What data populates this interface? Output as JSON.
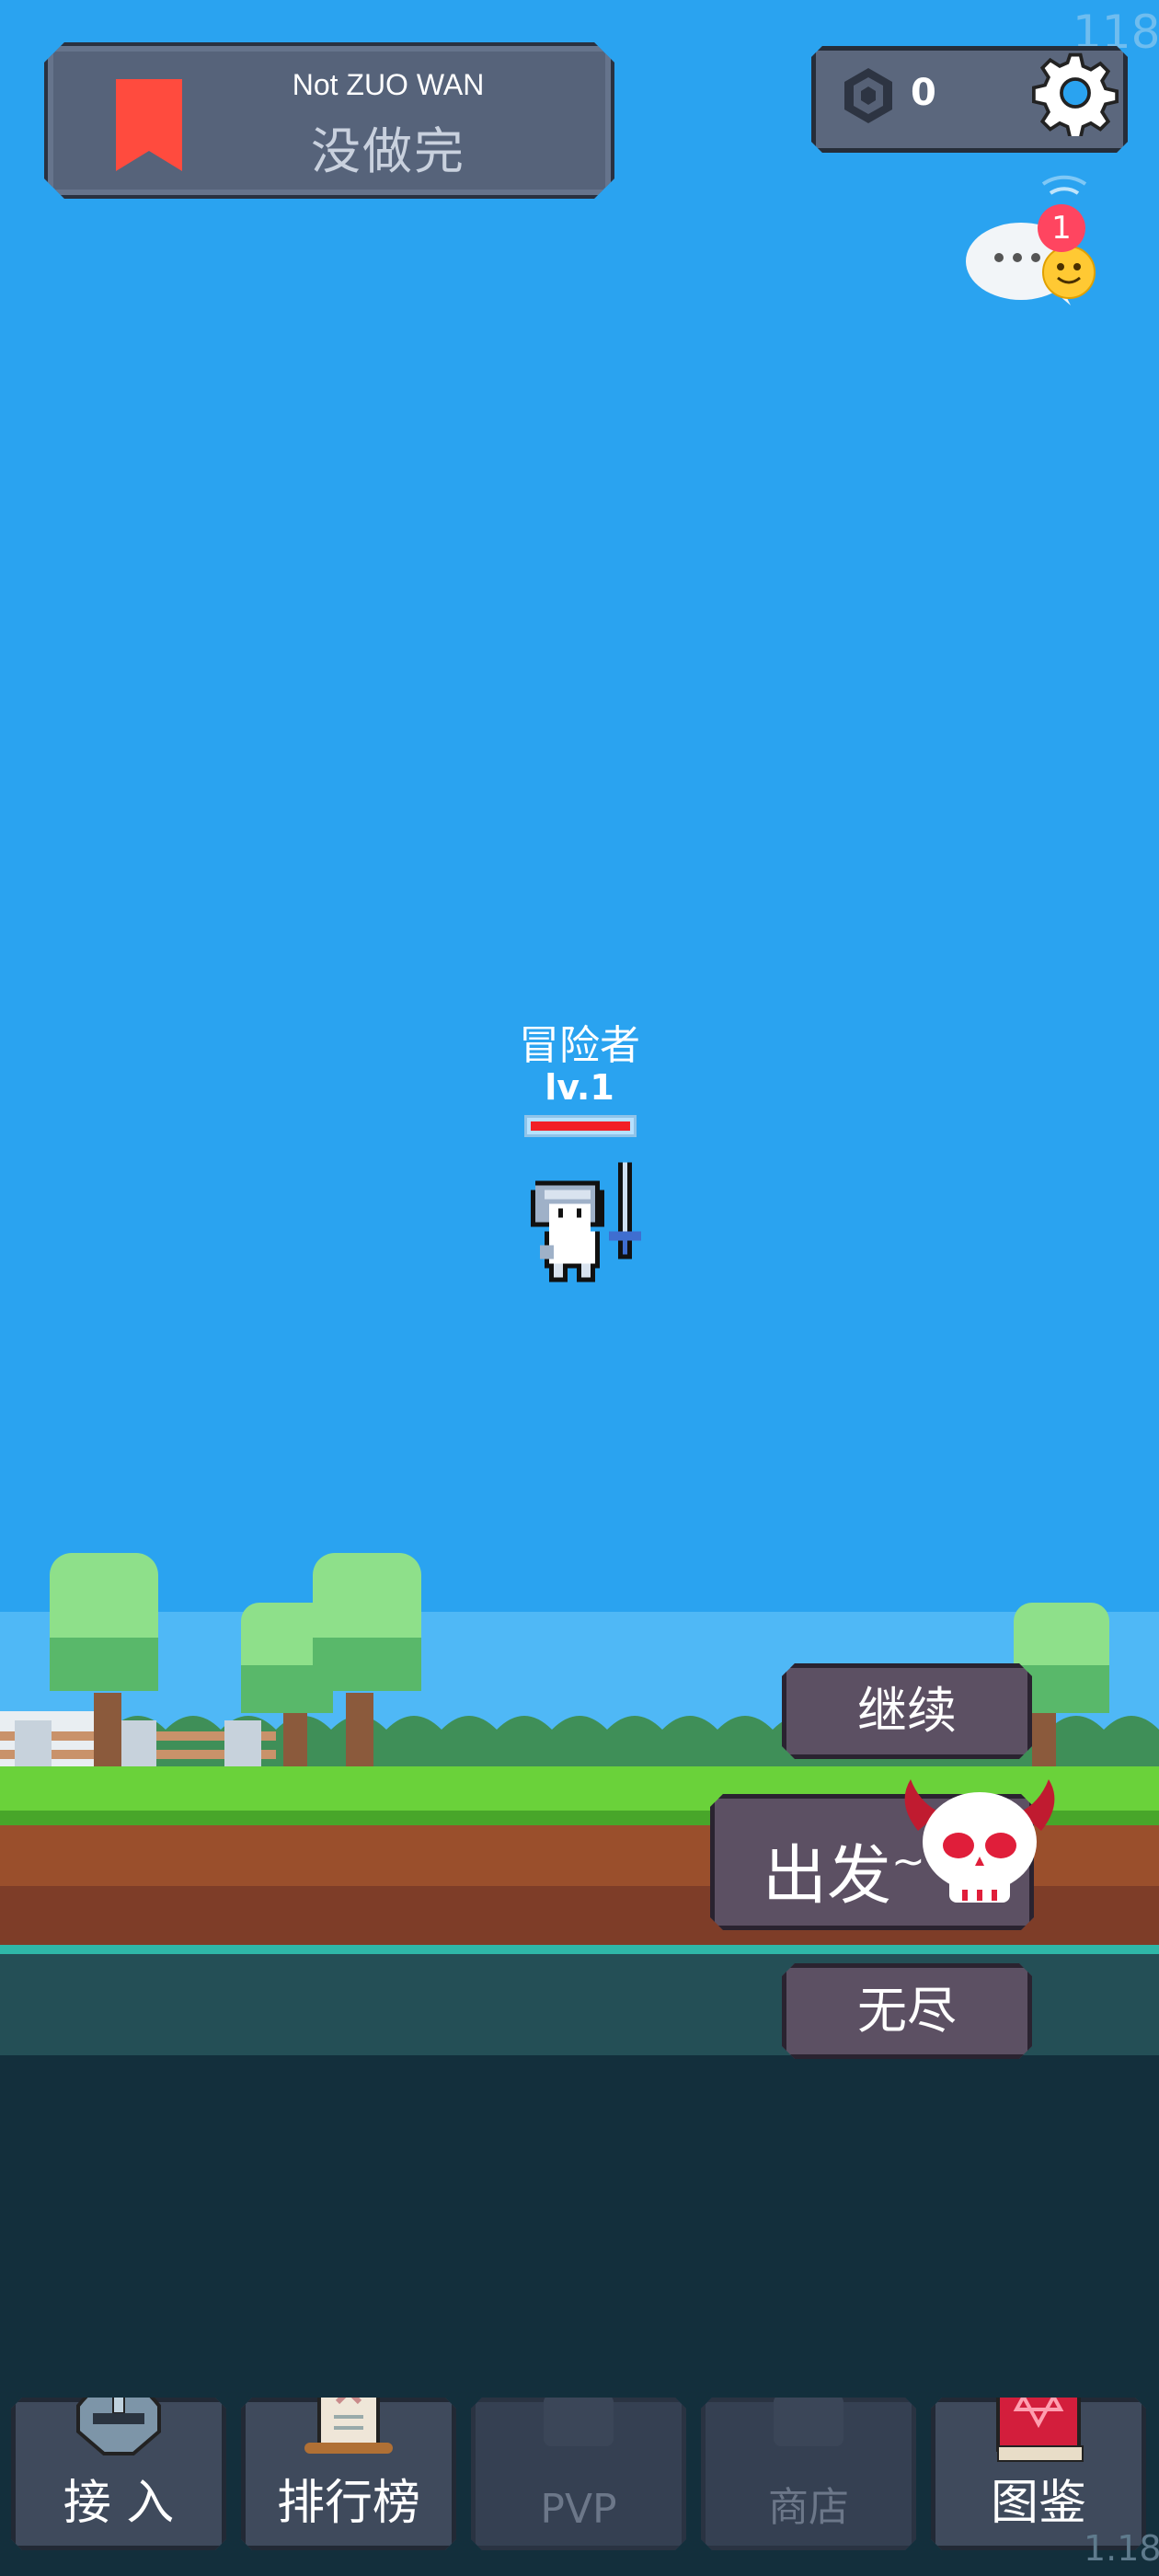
{
  "header": {
    "subtitle": "Not ZUO WAN",
    "title": "没做完"
  },
  "currency": {
    "value": "0"
  },
  "fps": "118",
  "chat": {
    "badge": "1"
  },
  "hero": {
    "name": "冒险者",
    "level": "lv.1",
    "hp_fraction": 1.0
  },
  "menu": {
    "continue_label": "继续",
    "depart_label": "出发",
    "depart_suffix": "~",
    "endless_label": "无尽"
  },
  "tabs": [
    {
      "label": "接 入",
      "locked": false
    },
    {
      "label": "排行榜",
      "locked": false
    },
    {
      "label": "PVP",
      "locked": true
    },
    {
      "label": "商店",
      "locked": true
    },
    {
      "label": "图鉴",
      "locked": false
    }
  ],
  "version": "1.18",
  "colors": {
    "sky": "#2aa3f0",
    "grass": "#6ad23a",
    "dirt": "#9a4f2c",
    "hp": "#f21f25",
    "bookmark": "#ff4b3e",
    "button": "#5c5063"
  }
}
